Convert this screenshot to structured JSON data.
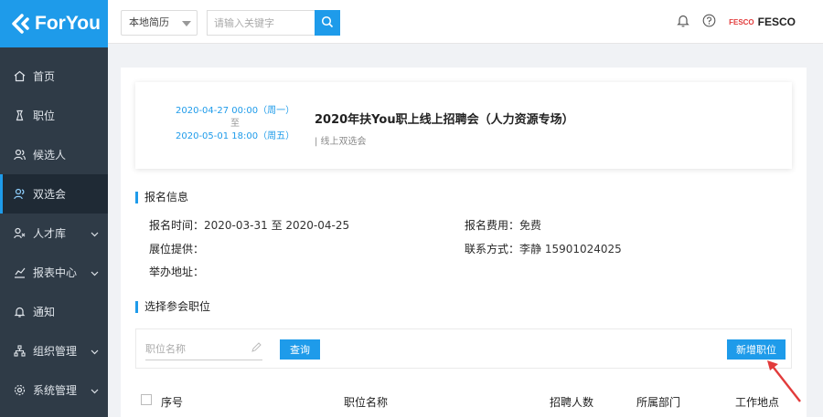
{
  "logo": {
    "text": "ForYou"
  },
  "sidebar": {
    "items": [
      {
        "label": "首页",
        "icon": "home-icon",
        "expandable": false
      },
      {
        "label": "职位",
        "icon": "briefcase-icon",
        "expandable": false
      },
      {
        "label": "候选人",
        "icon": "users-icon",
        "expandable": false
      },
      {
        "label": "双选会",
        "icon": "users-meet-icon",
        "expandable": false,
        "active": true
      },
      {
        "label": "人才库",
        "icon": "talent-icon",
        "expandable": true
      },
      {
        "label": "报表中心",
        "icon": "chart-icon",
        "expandable": true
      },
      {
        "label": "通知",
        "icon": "bell-icon",
        "expandable": false
      },
      {
        "label": "组织管理",
        "icon": "org-icon",
        "expandable": true
      },
      {
        "label": "系统管理",
        "icon": "gear-icon",
        "expandable": true
      }
    ]
  },
  "topbar": {
    "select_value": "本地简历",
    "search_placeholder": "请输入关键字",
    "brand_small": "FESCO",
    "brand_name": "FESCO"
  },
  "event": {
    "date_start": "2020-04-27 00:00（周一）",
    "date_sep": "至",
    "date_end": "2020-05-01 18:00（周五）",
    "title": "2020年扶You职上线上招聘会（人力资源专场）",
    "subtitle": "| 线上双选会"
  },
  "signup": {
    "section_title": "报名信息",
    "time_label": "报名时间：",
    "time_value": "2020-03-31 至 2020-04-25",
    "fee_label": "报名费用：",
    "fee_value": "免费",
    "booth_label": "展位提供：",
    "booth_value": "",
    "contact_label": "联系方式：",
    "contact_value": "李静 15901024025",
    "address_label": "举办地址：",
    "address_value": ""
  },
  "positions": {
    "section_title": "选择参会职位",
    "input_placeholder": "职位名称",
    "query_label": "查询",
    "add_label": "新增职位",
    "columns": [
      "序号",
      "职位名称",
      "招聘人数",
      "所属部门",
      "工作地点"
    ]
  },
  "colors": {
    "accent": "#1e9bea",
    "sidebar": "#2f3b47",
    "arrow": "#e23b3b"
  }
}
